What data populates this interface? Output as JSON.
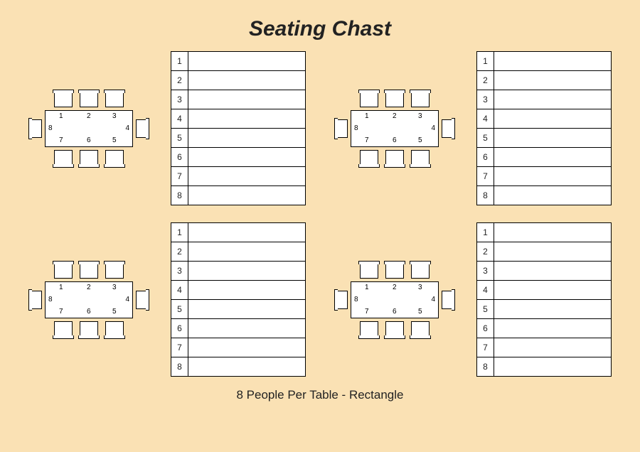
{
  "title": "Seating Chast",
  "footer": "8 People Per Table - Rectangle",
  "seat_numbers": [
    "1",
    "2",
    "3",
    "4",
    "5",
    "6",
    "7",
    "8"
  ],
  "tables": [
    {
      "rows": [
        "1",
        "2",
        "3",
        "4",
        "5",
        "6",
        "7",
        "8"
      ]
    },
    {
      "rows": [
        "1",
        "2",
        "3",
        "4",
        "5",
        "6",
        "7",
        "8"
      ]
    },
    {
      "rows": [
        "1",
        "2",
        "3",
        "4",
        "5",
        "6",
        "7",
        "8"
      ]
    },
    {
      "rows": [
        "1",
        "2",
        "3",
        "4",
        "5",
        "6",
        "7",
        "8"
      ]
    }
  ]
}
